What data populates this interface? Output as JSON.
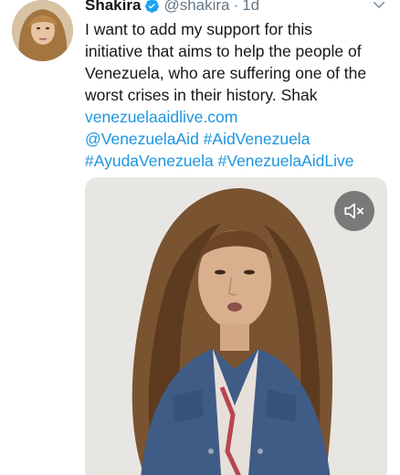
{
  "tweet": {
    "author_name": "Shakira",
    "handle": "@shakira",
    "separator": "·",
    "time": "1d",
    "text_lines": [
      "I want to add my support for this",
      "initiative that aims to help the people of",
      "Venezuela, who are suffering one of the",
      "worst crises in their history. Shak"
    ],
    "link": "venezuelaaidlive.com",
    "hashtag_line_1": "@VenezuelaAid #AidVenezuela",
    "hashtag_line_2": "#AyudaVenezuela #VenezuelaAidLive"
  },
  "icons": {
    "verified": "verified-badge-icon",
    "menu": "chevron-down-icon",
    "mute": "speaker-muted-icon"
  },
  "colors": {
    "text": "#14171a",
    "muted": "#657786",
    "link": "#1b95e0",
    "verified": "#1da1f2"
  }
}
